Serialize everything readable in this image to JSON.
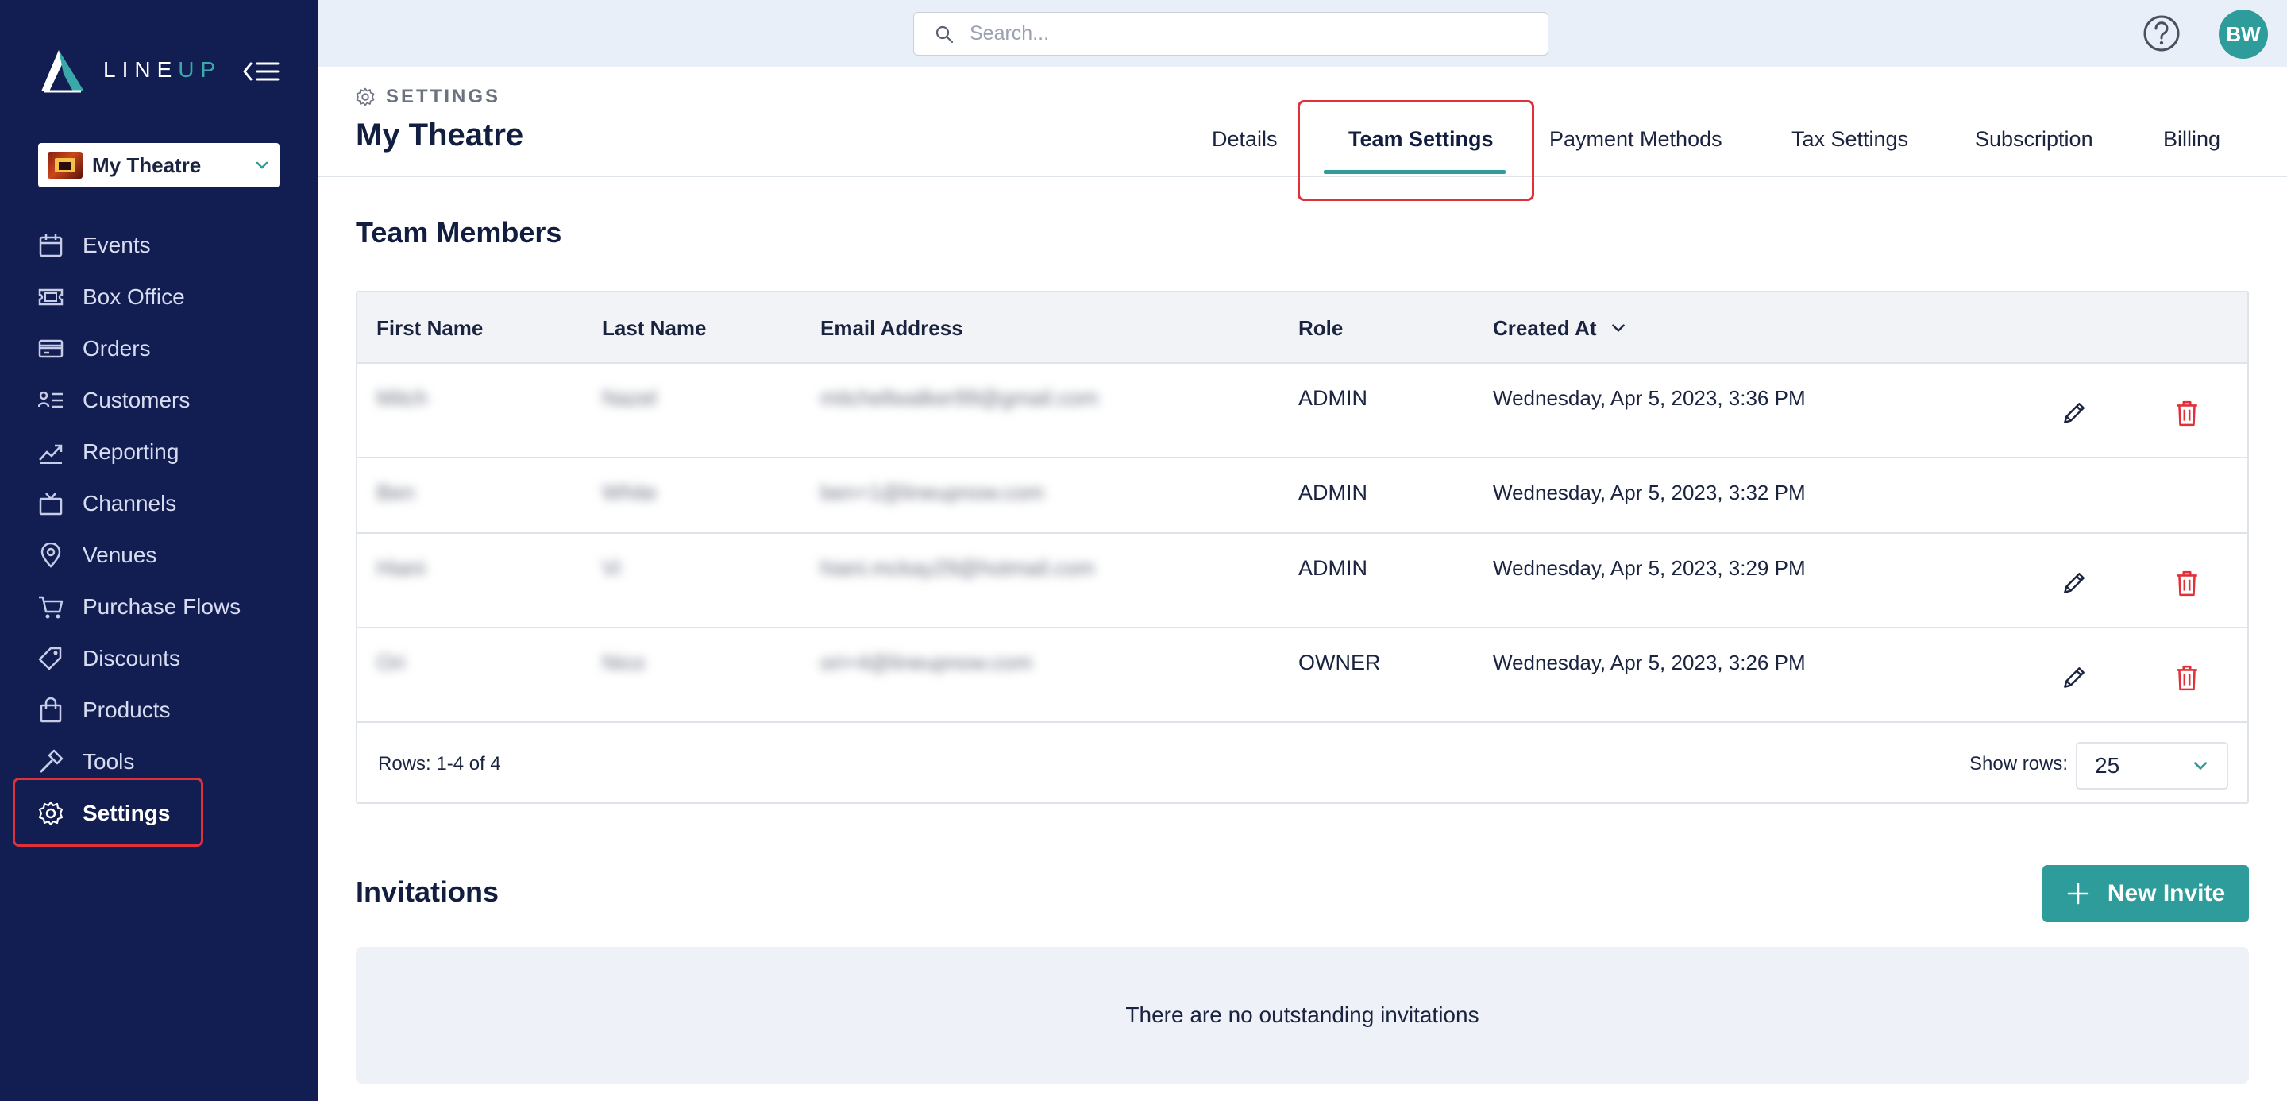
{
  "brand": {
    "name_left": "LINE",
    "name_right": "UP",
    "accent": "#2e9c9a",
    "sidebar_bg": "#121e52",
    "highlight": "#e0303a"
  },
  "sidebar": {
    "org": {
      "name": "My Theatre"
    },
    "items": [
      {
        "label": "Events",
        "icon": "calendar-icon"
      },
      {
        "label": "Box Office",
        "icon": "ticket-icon"
      },
      {
        "label": "Orders",
        "icon": "credit-card-icon"
      },
      {
        "label": "Customers",
        "icon": "customers-list-icon"
      },
      {
        "label": "Reporting",
        "icon": "trend-chart-icon"
      },
      {
        "label": "Channels",
        "icon": "tv-icon"
      },
      {
        "label": "Venues",
        "icon": "map-pin-icon"
      },
      {
        "label": "Purchase Flows",
        "icon": "cart-icon"
      },
      {
        "label": "Discounts",
        "icon": "tags-icon"
      },
      {
        "label": "Products",
        "icon": "shopping-bag-icon"
      },
      {
        "label": "Tools",
        "icon": "hammer-icon"
      },
      {
        "label": "Settings",
        "icon": "gear-icon",
        "active": true
      }
    ]
  },
  "topbar": {
    "search_placeholder": "Search...",
    "avatar_initials": "BW"
  },
  "header": {
    "crumb": "SETTINGS",
    "title": "My Theatre",
    "tabs": [
      {
        "label": "Details"
      },
      {
        "label": "Team Settings",
        "active": true
      },
      {
        "label": "Payment Methods"
      },
      {
        "label": "Tax Settings"
      },
      {
        "label": "Subscription"
      },
      {
        "label": "Billing"
      }
    ]
  },
  "team": {
    "title": "Team Members",
    "columns": [
      "First Name",
      "Last Name",
      "Email Address",
      "Role",
      "Created At"
    ],
    "rows": [
      {
        "first": "Mitch",
        "last": "Nazel",
        "email": "mitchellwalker99@gmail.com",
        "role": "ADMIN",
        "created": "Wednesday, Apr 5, 2023, 3:36 PM"
      },
      {
        "first": "Ben",
        "last": "White",
        "email": "ben+1@lineupnow.com",
        "role": "ADMIN",
        "created": "Wednesday, Apr 5, 2023, 3:32 PM"
      },
      {
        "first": "Hiani",
        "last": "Vi",
        "email": "hiani.mckay29@hotmail.com",
        "role": "ADMIN",
        "created": "Wednesday, Apr 5, 2023, 3:29 PM"
      },
      {
        "first": "Ori",
        "last": "Nico",
        "email": "ori+4@lineupnow.com",
        "role": "OWNER",
        "created": "Wednesday, Apr 5, 2023, 3:26 PM"
      }
    ],
    "rows_count": "Rows: 1-4 of 4",
    "show_rows_label": "Show rows:",
    "show_rows_value": "25"
  },
  "invitations": {
    "title": "Invitations",
    "new_invite_label": "New Invite",
    "empty_text": "There are no outstanding invitations"
  }
}
